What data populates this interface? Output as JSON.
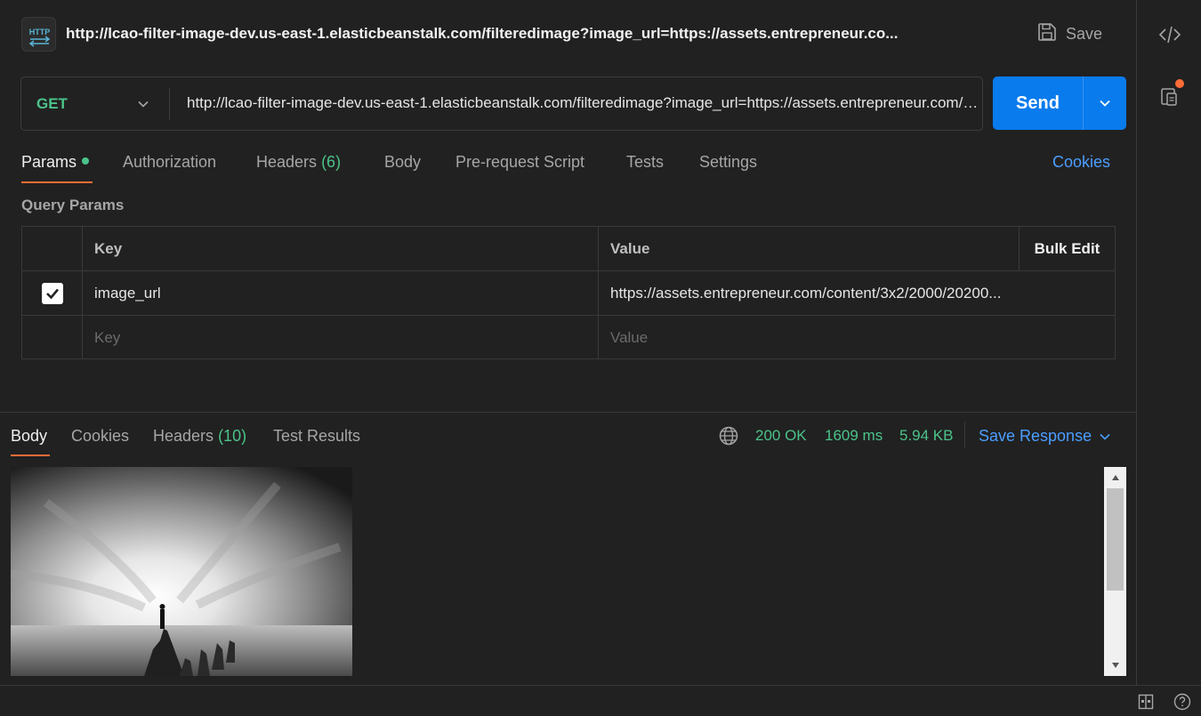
{
  "request": {
    "title_url": "http://lcao-filter-image-dev.us-east-1.elasticbeanstalk.com/filteredimage?image_url=https://assets.entrepreneur.co...",
    "method": "GET",
    "url": "http://lcao-filter-image-dev.us-east-1.elasticbeanstalk.com/filteredimage?image_url=https://assets.entrepreneur.com/content/3x2/2000/20200...",
    "save_label": "Save",
    "send_label": "Send",
    "http_icon_text": "HTTP"
  },
  "request_tabs": {
    "params": "Params",
    "authorization": "Authorization",
    "headers": "Headers",
    "headers_count": "(6)",
    "body": "Body",
    "pre_request": "Pre-request Script",
    "tests": "Tests",
    "settings": "Settings",
    "cookies": "Cookies"
  },
  "query_params": {
    "title": "Query Params",
    "header_key": "Key",
    "header_value": "Value",
    "bulk_edit": "Bulk Edit",
    "rows": [
      {
        "checked": true,
        "key": "image_url",
        "value": "https://assets.entrepreneur.com/content/3x2/2000/20200..."
      }
    ],
    "placeholder_key": "Key",
    "placeholder_value": "Value"
  },
  "response": {
    "tabs": {
      "body": "Body",
      "cookies": "Cookies",
      "headers": "Headers",
      "headers_count": "(10)",
      "test_results": "Test Results"
    },
    "status": "200 OK",
    "time": "1609 ms",
    "size": "5.94 KB",
    "save_response": "Save Response"
  },
  "colors": {
    "accent": "#ff6c37",
    "send": "#097bed",
    "link": "#4b9eff",
    "success": "#4cc38a",
    "background": "#212121"
  }
}
